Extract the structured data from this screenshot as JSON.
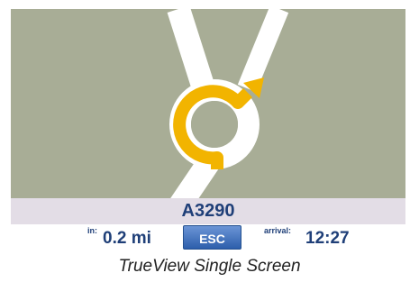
{
  "navigation": {
    "road_name": "A3290",
    "distance": {
      "label": "in:",
      "value": "0.2 mi"
    },
    "esc_label": "ESC",
    "arrival": {
      "label": "arrival:",
      "value": "12:27"
    }
  },
  "caption": "TrueView Single Screen",
  "colors": {
    "map_background": "#a8ad96",
    "road": "#ffffff",
    "route": "#f2b400",
    "text": "#1f3f78",
    "button": "#3d6fc0"
  }
}
